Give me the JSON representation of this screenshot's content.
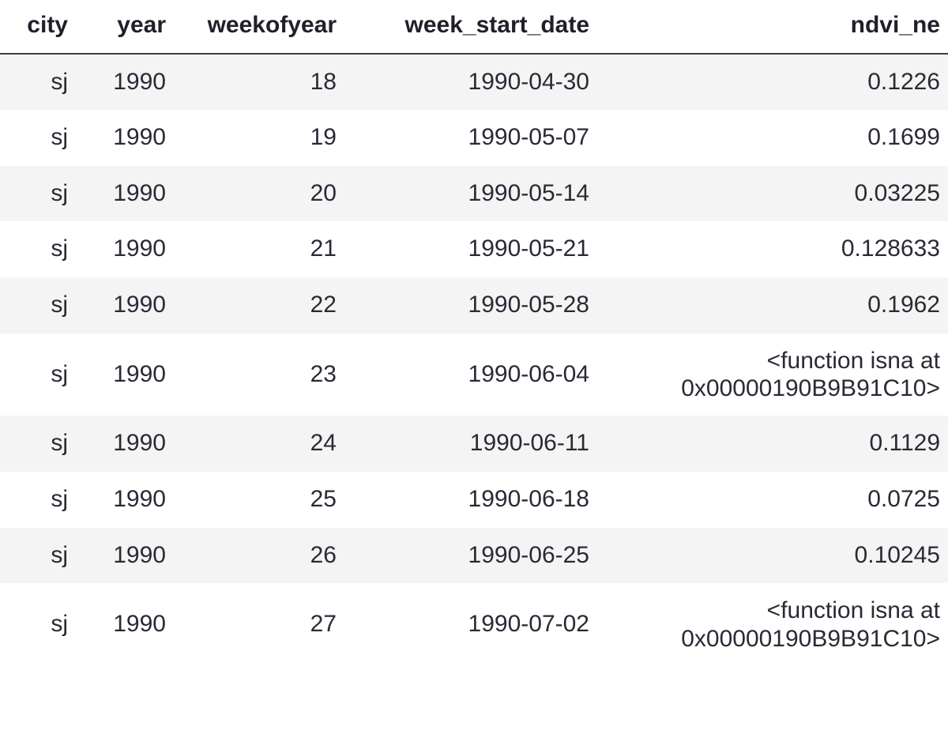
{
  "table": {
    "columns": [
      {
        "key": "city",
        "label": "city",
        "align": "right"
      },
      {
        "key": "year",
        "label": "year",
        "align": "right"
      },
      {
        "key": "weekofyear",
        "label": "weekofyear",
        "align": "right"
      },
      {
        "key": "week_start_date",
        "label": "week_start_date",
        "align": "right"
      },
      {
        "key": "ndvi_ne",
        "label": "ndvi_ne",
        "align": "right"
      }
    ],
    "rows": [
      {
        "city": "sj",
        "year": "1990",
        "weekofyear": "18",
        "week_start_date": "1990-04-30",
        "ndvi_ne": "0.1226"
      },
      {
        "city": "sj",
        "year": "1990",
        "weekofyear": "19",
        "week_start_date": "1990-05-07",
        "ndvi_ne": "0.1699"
      },
      {
        "city": "sj",
        "year": "1990",
        "weekofyear": "20",
        "week_start_date": "1990-05-14",
        "ndvi_ne": "0.03225"
      },
      {
        "city": "sj",
        "year": "1990",
        "weekofyear": "21",
        "week_start_date": "1990-05-21",
        "ndvi_ne": "0.128633"
      },
      {
        "city": "sj",
        "year": "1990",
        "weekofyear": "22",
        "week_start_date": "1990-05-28",
        "ndvi_ne": "0.1962"
      },
      {
        "city": "sj",
        "year": "1990",
        "weekofyear": "23",
        "week_start_date": "1990-06-04",
        "ndvi_ne": "<function isna at 0x00000190B9B91C10>"
      },
      {
        "city": "sj",
        "year": "1990",
        "weekofyear": "24",
        "week_start_date": "1990-06-11",
        "ndvi_ne": "0.1129"
      },
      {
        "city": "sj",
        "year": "1990",
        "weekofyear": "25",
        "week_start_date": "1990-06-18",
        "ndvi_ne": "0.0725"
      },
      {
        "city": "sj",
        "year": "1990",
        "weekofyear": "26",
        "week_start_date": "1990-06-25",
        "ndvi_ne": "0.10245"
      },
      {
        "city": "sj",
        "year": "1990",
        "weekofyear": "27",
        "week_start_date": "1990-07-02",
        "ndvi_ne": "<function isna at 0x00000190B9B91C10>"
      }
    ]
  },
  "style": {
    "header_text_color": "#20202c",
    "header_rule_color": "#3b3b48",
    "stripe_color": "#f4f4f4",
    "row_color": "#ffffff",
    "body_text_color": "#2a2a36"
  }
}
